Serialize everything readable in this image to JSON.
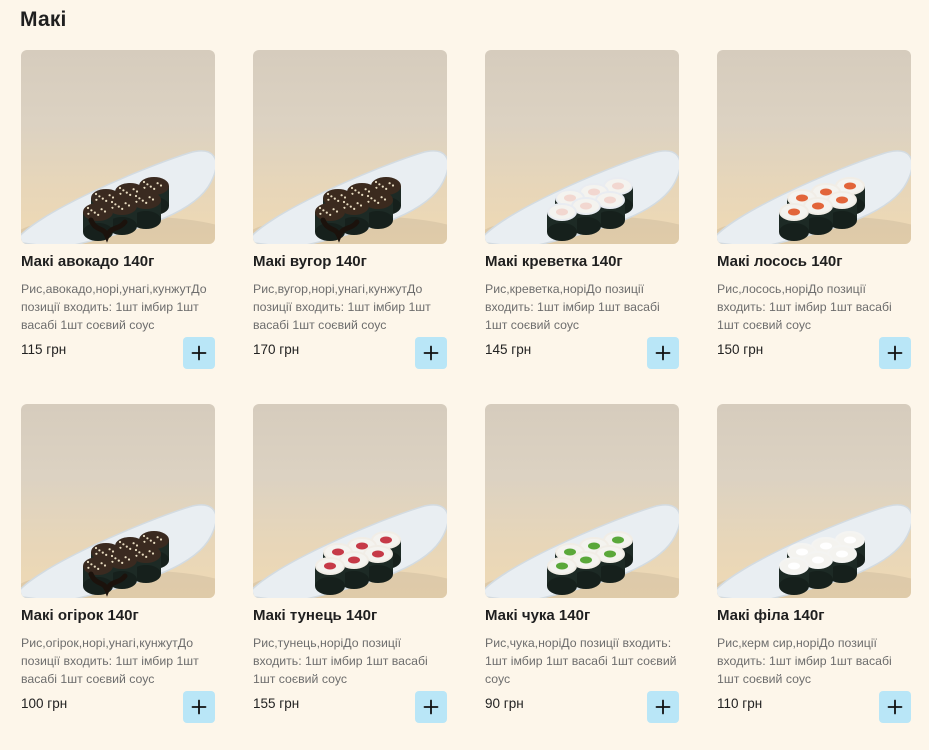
{
  "section": {
    "title": "Макі"
  },
  "items": [
    {
      "name": "Макі авокадо 140г",
      "description": "Рис,авокадо,норі,унагі,кунжутДо позиції входить: 1шт імбир 1шт васабі 1шт соєвий соус",
      "price": "115 грн",
      "filling": "avocado"
    },
    {
      "name": "Макі вугор 140г",
      "description": "Рис,вугор,норі,унагі,кунжутДо позиції входить: 1шт імбир 1шт васабі 1шт соєвий соус",
      "price": "170 грн",
      "filling": "eel"
    },
    {
      "name": "Макі креветка 140г",
      "description": "Рис,креветка,норіДо позиції входить: 1шт імбир 1шт васабі 1шт соєвий соус",
      "price": "145 грн",
      "filling": "shrimp"
    },
    {
      "name": "Макі лосось 140г",
      "description": "Рис,лосось,норіДо позиції входить: 1шт імбир 1шт васабі 1шт соєвий соус",
      "price": "150 грн",
      "filling": "salmon"
    },
    {
      "name": "Макі огірок 140г",
      "description": "Рис,огірок,норі,унагі,кунжутДо позиції входить: 1шт імбир 1шт васабі 1шт соєвий соус",
      "price": "100 грн",
      "filling": "cucumber"
    },
    {
      "name": "Макі тунець 140г",
      "description": "Рис,тунець,норіДо позиції входить: 1шт імбир 1шт васабі 1шт соєвий соус",
      "price": "155 грн",
      "filling": "tuna"
    },
    {
      "name": "Макі чука 140г",
      "description": "Рис,чука,норіДо позиції входить: 1шт імбир 1шт васабі 1шт соєвий соус",
      "price": "90 грн",
      "filling": "chuka"
    },
    {
      "name": "Макі філа 140г",
      "description": "Рис,керм сир,норіДо позиції входить: 1шт імбир 1шт васабі 1шт соєвий соус",
      "price": "110 грн",
      "filling": "cheese"
    }
  ],
  "icons": {
    "add": "plus-icon"
  },
  "colors": {
    "background": "#fdf6ea",
    "add_button": "#b9e6f7"
  }
}
